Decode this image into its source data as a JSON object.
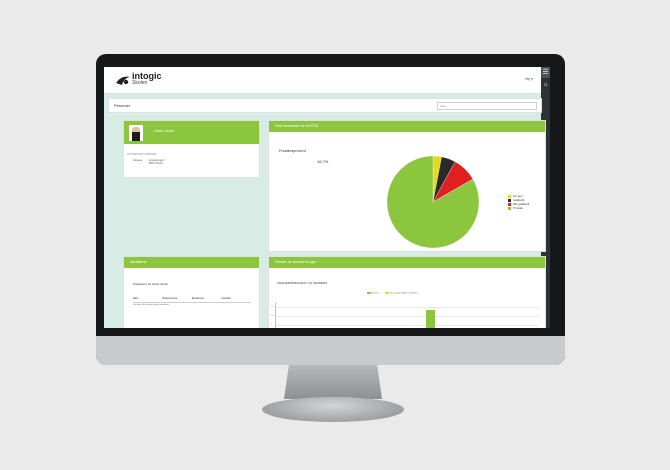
{
  "app": {
    "logo_name": "intogic",
    "logo_sub": "Skolen",
    "user": "Hej ▾",
    "menu_icon": "☰",
    "home_icon": "⌂"
  },
  "page": {
    "title": "Personer",
    "search_placeholder": "Søg..."
  },
  "profile": {
    "name": "Hans Junior",
    "section_label": "KONTAKTOPLYSNINGER",
    "address_label": "Adresse",
    "address_line1": "Lindevænget 7",
    "address_line2": "8600 Horsby"
  },
  "pie_card": {
    "header": "Fast fremmøde for HH/T25",
    "chart_title": "Fraværsprocent",
    "pct_label": "16,7%"
  },
  "chart_data": {
    "type": "pie",
    "title": "Fraværsprocent",
    "slices": [
      {
        "label": "For sent",
        "value": 3,
        "color": "#e8d820"
      },
      {
        "label": "Godkendt",
        "value": 5,
        "color": "#2a2a2a"
      },
      {
        "label": "Ikke godkendt",
        "value": 8.7,
        "color": "#e02020"
      },
      {
        "label": "Til stede",
        "value": 83.3,
        "color": "#8cc63f"
      }
    ],
    "legend_position": "right"
  },
  "grades": {
    "header": "Karakterer",
    "subtitle": "Karakterer for Hans Junior",
    "columns": [
      "Dato",
      "Bedømmelse",
      "Bedømmer",
      "Karakter"
    ],
    "empty_text": "Der blev ikke fundet nogle karakterer."
  },
  "absence": {
    "header": "Fravær de seneste 6 uger",
    "title": "FRAVÆRSPROCENT OG TENDENS",
    "legend": [
      "Fravær",
      "Fra samlet forløb % tendens"
    ],
    "ticks": [
      "15",
      "10",
      "5"
    ]
  }
}
